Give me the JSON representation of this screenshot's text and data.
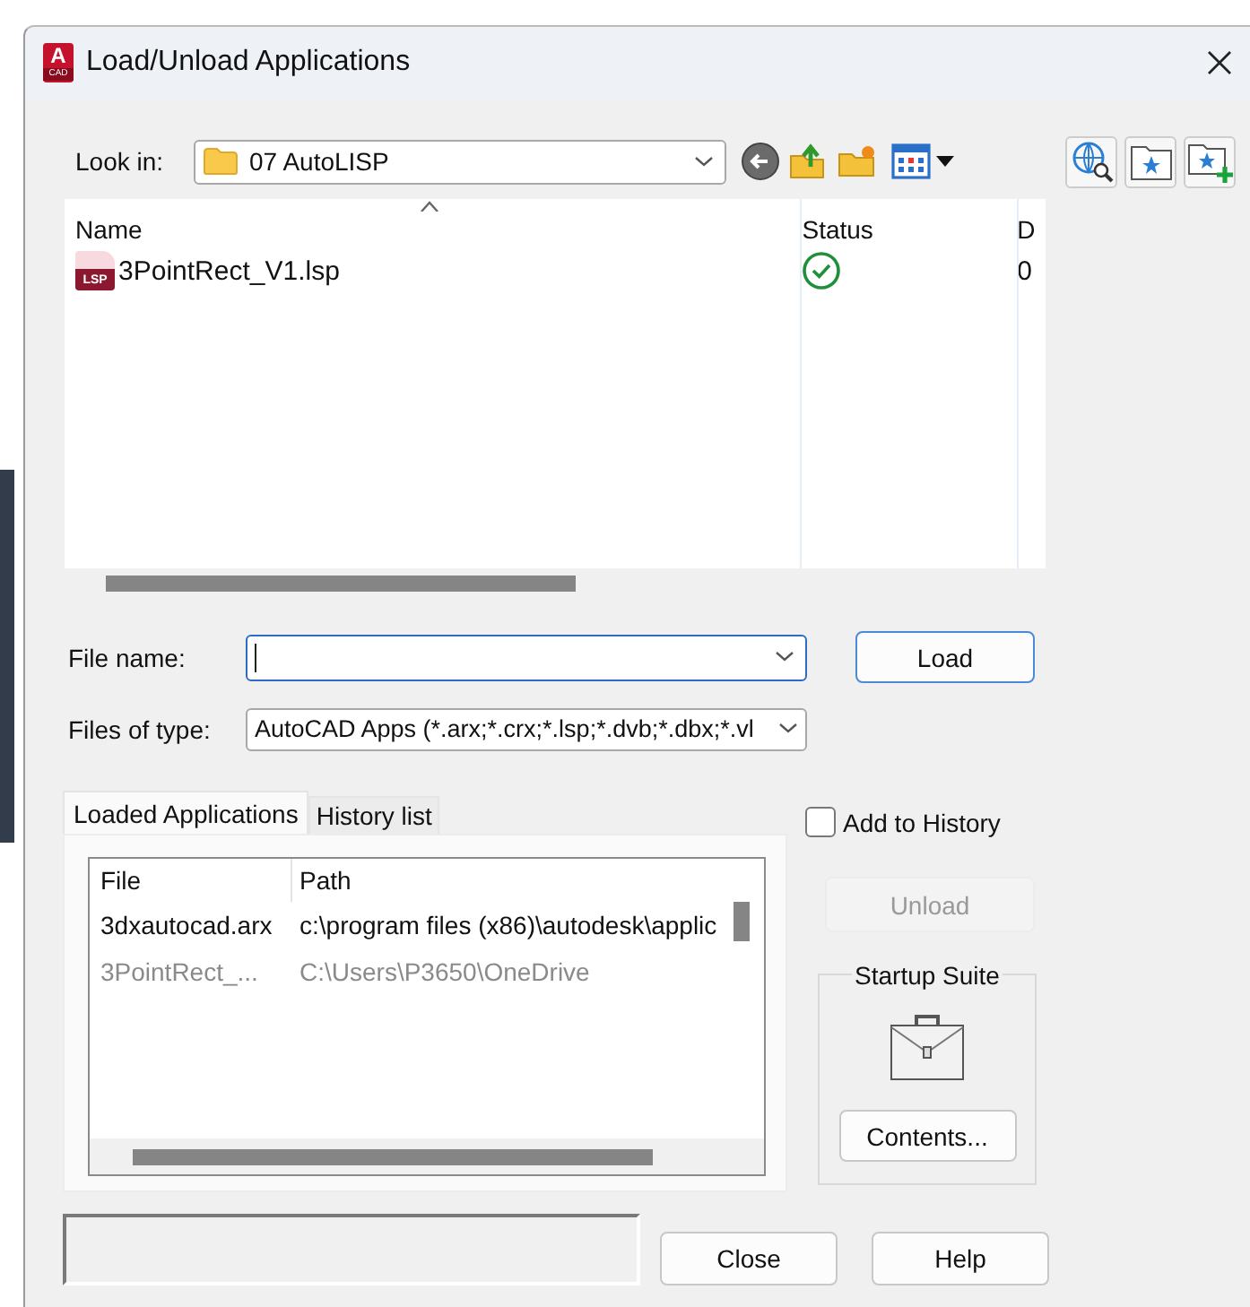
{
  "window": {
    "title": "Load/Unload Applications",
    "icon_letter": "A",
    "icon_caption": "CAD"
  },
  "look_in": {
    "label": "Look in:",
    "value": "07 AutoLISP"
  },
  "file_list": {
    "columns": [
      "Name",
      "Status",
      "D"
    ],
    "rows": [
      {
        "icon_label": "LSP",
        "name": "3PointRect_V1.lsp",
        "loaded": true,
        "column_3": "0"
      }
    ]
  },
  "file_name": {
    "label": "File name:",
    "focused": true
  },
  "files_of_type": {
    "label": "Files of type:",
    "value": "AutoCAD Apps (*.arx;*.crx;*.lsp;*.dvb;*.dbx;*.vl"
  },
  "load_button": "Load",
  "tabs": [
    {
      "label": "Loaded Applications",
      "selected": true
    },
    {
      "label": "History list",
      "selected": false
    }
  ],
  "loaded_apps": {
    "columns": [
      "File",
      "Path"
    ],
    "rows": [
      {
        "file": "3dxautocad.arx",
        "path": "c:\\program files (x86)\\autodesk\\applic",
        "disabled": false
      },
      {
        "file": "3PointRect_...",
        "path": "C:\\Users\\P3650\\OneDrive",
        "disabled": true
      }
    ]
  },
  "add_to_history": {
    "label": "Add to History",
    "checked": false
  },
  "unload_button": {
    "label": "Unload",
    "disabled": true
  },
  "startup_suite": {
    "title": "Startup Suite",
    "button": "Contents..."
  },
  "buttons": [
    "Close",
    "Help"
  ]
}
